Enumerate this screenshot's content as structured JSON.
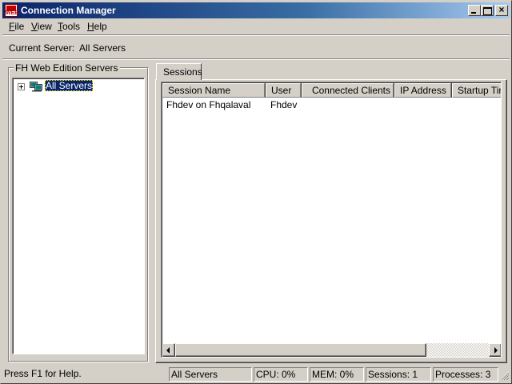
{
  "window": {
    "title": "Connection Manager",
    "app_icon_text": "WEB"
  },
  "menu": {
    "file": {
      "mnemonic": "F",
      "rest": "ile"
    },
    "view": {
      "mnemonic": "V",
      "rest": "iew"
    },
    "tools": {
      "mnemonic": "T",
      "rest": "ools"
    },
    "help": {
      "mnemonic": "H",
      "rest": "elp"
    }
  },
  "current_server": {
    "text": "Current Server:  All Servers"
  },
  "servers_panel": {
    "group_label": "FH Web Edition Servers",
    "tree": [
      {
        "label": "All Servers",
        "selected": true,
        "expanded": false,
        "icon": "server-group-icon"
      }
    ]
  },
  "sessions_panel": {
    "tab_label": "Sessions",
    "columns": [
      "Session Name",
      "User",
      "Connected Clients",
      "IP Address",
      "Startup Tim"
    ],
    "rows": [
      {
        "session_name": "Fhdev on Fhqalaval",
        "user": "Fhdev",
        "connected_clients": "",
        "ip_address": "",
        "startup_time": ""
      }
    ]
  },
  "statusbar": {
    "help": "Press F1 for Help.",
    "server": "All Servers",
    "cpu": "CPU: 0%",
    "mem": "MEM: 0%",
    "sessions": "Sessions: 1",
    "processes": "Processes: 3"
  },
  "colors": {
    "titlebar_start": "#0a246a",
    "titlebar_end": "#a6caf0",
    "face": "#d4d0c8",
    "selection": "#0a246a"
  }
}
